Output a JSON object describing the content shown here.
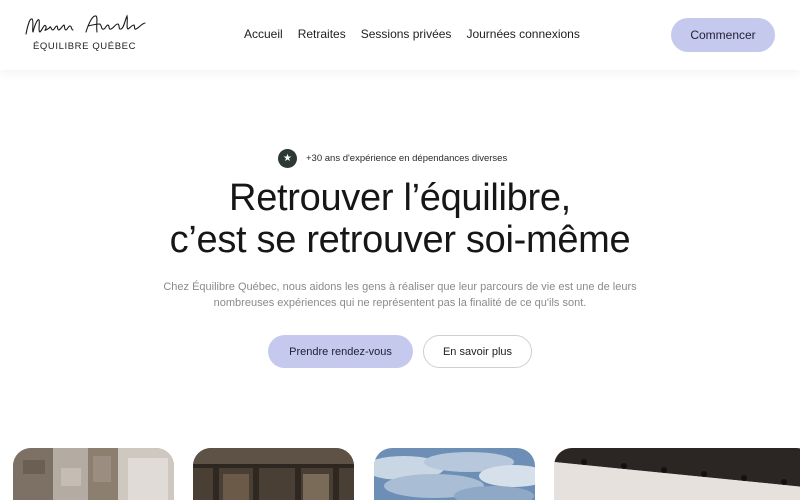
{
  "header": {
    "logo_signature": "Marlène Asselin",
    "logo_subtitle": "ÉQUILIBRE QUÉBEC",
    "nav": [
      {
        "label": "Accueil"
      },
      {
        "label": "Retraites"
      },
      {
        "label": "Sessions privées"
      },
      {
        "label": "Journées connexions"
      }
    ],
    "cta_label": "Commencer"
  },
  "hero": {
    "badge_icon": "star-icon",
    "badge_text": "+30 ans d'expérience en dépendances diverses",
    "title_line1": "Retrouver l’équilibre,",
    "title_line2": "c’est se retrouver soi-même",
    "description": "Chez Équilibre Québec, nous aidons les gens à réaliser que leur parcours de vie est une de leurs nombreuses expériences qui ne représentent pas la finalité de ce qu'ils sont.",
    "primary_button": "Prendre rendez-vous",
    "secondary_button": "En savoir plus"
  },
  "gallery": [
    {
      "icon": "stone-wall-photo"
    },
    {
      "icon": "wooden-cabin-photo"
    },
    {
      "icon": "sky-clouds-photo"
    },
    {
      "icon": "interior-ceiling-lights-photo"
    }
  ],
  "colors": {
    "accent_button": "#c6c9ee",
    "badge_icon_bg": "#2d3a33",
    "text_primary": "#161616",
    "text_muted": "#8a8a8a"
  }
}
